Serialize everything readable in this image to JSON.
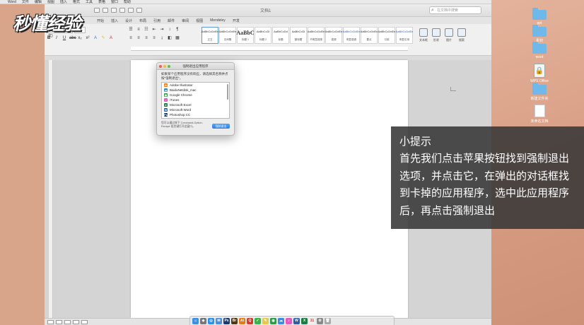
{
  "logo": "秒懂经验",
  "menubar": {
    "items": [
      "Word",
      "文件",
      "编辑",
      "视图",
      "插入",
      "格式",
      "工具",
      "表格",
      "窗口",
      "帮助"
    ],
    "right": [
      "🔊",
      "◉",
      "周四 15:42",
      "🔍",
      "≡"
    ]
  },
  "word": {
    "doc_title": "文档1",
    "search_placeholder": "在文档中搜索",
    "tabs": [
      "开始",
      "插入",
      "设计",
      "布局",
      "引用",
      "邮件",
      "审阅",
      "视图",
      "Mendeley",
      "开发"
    ],
    "font_name": "宋体 (中文正文)",
    "font_size": "12",
    "styles": [
      {
        "sample": "AaBbCcDdEe",
        "name": "正文",
        "big": false,
        "blue": false,
        "active": true
      },
      {
        "sample": "AaBbCcDdEe",
        "name": "无间隔",
        "big": false,
        "blue": false,
        "active": false
      },
      {
        "sample": "AaBbC",
        "name": "标题 1",
        "big": true,
        "blue": false,
        "active": false
      },
      {
        "sample": "AaBbCcDi",
        "name": "标题 2",
        "big": false,
        "blue": false,
        "active": false
      },
      {
        "sample": "AaBbCcDd",
        "name": "标题",
        "big": false,
        "blue": false,
        "active": false
      },
      {
        "sample": "AaBbCcDi",
        "name": "副标题",
        "big": false,
        "blue": false,
        "active": false
      },
      {
        "sample": "AaBbCcDdEe",
        "name": "不明显强调",
        "big": false,
        "blue": false,
        "active": false
      },
      {
        "sample": "AaBbCcDdEe",
        "name": "强调",
        "big": false,
        "blue": false,
        "active": false
      },
      {
        "sample": "AaBbCcDdEe",
        "name": "明显强调",
        "big": false,
        "blue": true,
        "active": false
      },
      {
        "sample": "AaBbCcDdEe",
        "name": "要点",
        "big": false,
        "blue": false,
        "active": false
      },
      {
        "sample": "AaBbCcDdEe",
        "name": "引用",
        "big": false,
        "blue": false,
        "active": false
      },
      {
        "sample": "AaBbCcDdEe",
        "name": "明显引用",
        "big": false,
        "blue": true,
        "active": false
      }
    ],
    "ribbon_right": [
      "文本框",
      "形状",
      "图片",
      "搜索"
    ]
  },
  "dialog": {
    "title": "强制退出应用程序",
    "message": "如果某个应用程序没有响应，请选择其名称并点按\"强制退出\"。",
    "apps": [
      {
        "name": "Adobe Illustrator",
        "icon": "Ai",
        "color": "#e67a1b"
      },
      {
        "name": "BaiduNetdisk_mac",
        "icon": "☁",
        "color": "#3b8de0"
      },
      {
        "name": "Google Chrome",
        "icon": "◉",
        "color": "#2f9a46"
      },
      {
        "name": "iTunes",
        "icon": "♪",
        "color": "#e45bbd"
      },
      {
        "name": "Microsoft Excel",
        "icon": "X",
        "color": "#1f7a45"
      },
      {
        "name": "Microsoft Word",
        "icon": "W",
        "color": "#2b5ca8"
      },
      {
        "name": "Photoshop CC",
        "icon": "Ps",
        "color": "#1e3a6b"
      },
      {
        "name": "QQ",
        "icon": "Q",
        "color": "#d43b2c"
      }
    ],
    "hint": "您可以通过按下 Command-Option-Escape 组合键打开此窗口。",
    "button": "强制退出"
  },
  "tip": {
    "title": "小提示",
    "body": "首先我们点击苹果按钮找到强制退出选项，并点击它，在弹出的对话框找到卡掉的应用程序，选中此应用程序后，再点击强制退出"
  },
  "desktop": {
    "items": [
      {
        "label": "ppt",
        "type": "folder"
      },
      {
        "label": "素材",
        "type": "folder"
      },
      {
        "label": "word",
        "type": "folder"
      },
      {
        "label": "WPS Office",
        "type": "lock"
      },
      {
        "label": "新建文件夹",
        "type": "folder"
      },
      {
        "label": "未命名文档",
        "type": "doc"
      }
    ]
  },
  "dock": {
    "icons": [
      {
        "name": "finder",
        "color": "#3d8fe0",
        "glyph": "☺"
      },
      {
        "name": "launchpad",
        "color": "#777",
        "glyph": "◆"
      },
      {
        "name": "safari",
        "color": "#2f8ee6",
        "glyph": "◎"
      },
      {
        "name": "mail",
        "color": "#4a90d9",
        "glyph": "✉"
      },
      {
        "name": "photoshop",
        "color": "#1e3a6b",
        "glyph": "Ps"
      },
      {
        "name": "bridge",
        "color": "#503718",
        "glyph": "Br"
      },
      {
        "name": "illustrator",
        "color": "#e67a1b",
        "glyph": "Ai"
      },
      {
        "name": "qq",
        "color": "#d43b2c",
        "glyph": "Q"
      },
      {
        "name": "wechat",
        "color": "#3fb04c",
        "glyph": "✓"
      },
      {
        "name": "notes",
        "color": "#e9c94a",
        "glyph": "✎"
      },
      {
        "name": "chrome",
        "color": "#2f9a46",
        "glyph": "◉"
      },
      {
        "name": "netdisk",
        "color": "#3b8de0",
        "glyph": "☁"
      },
      {
        "name": "itunes",
        "color": "#e45bbd",
        "glyph": "♪"
      },
      {
        "name": "word",
        "color": "#2b5ca8",
        "glyph": "W"
      },
      {
        "name": "excel",
        "color": "#1f7a45",
        "glyph": "X"
      },
      {
        "name": "calendar",
        "color": "#f0f0f0",
        "glyph": "31"
      },
      {
        "name": "preferences",
        "color": "#888",
        "glyph": "⚙"
      },
      {
        "name": "trash",
        "color": "#aaa",
        "glyph": "🗑"
      }
    ]
  }
}
